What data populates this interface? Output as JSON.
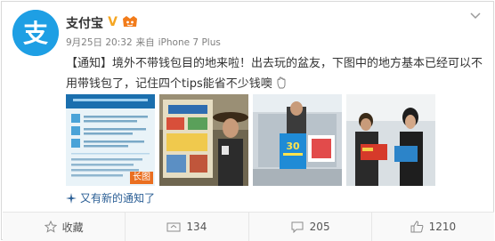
{
  "user": {
    "name": "支付宝",
    "verified_badge": "V"
  },
  "meta": {
    "date": "9月25日 20:32",
    "from_label": "来自",
    "device": "iPhone 7 Plus"
  },
  "post": {
    "text": "【通知】境外不带钱包目的地来啦！出去玩的盆友，下图中的地方基本已经可以不用带钱包了，记住四个tips能省不少钱噢"
  },
  "thumbnails": [
    {
      "kind": "long-image",
      "badge": "长图",
      "scene": "infographic"
    },
    {
      "kind": "photo",
      "scene": "shop-map"
    },
    {
      "kind": "photo",
      "scene": "store-display"
    },
    {
      "kind": "photo",
      "scene": "travelers-reading"
    }
  ],
  "notice_link": "又有新的通知了",
  "actions": {
    "favorite": "收藏",
    "repost": "134",
    "comment": "205",
    "like": "1210"
  },
  "colors": {
    "brand_blue": "#1e9fe4",
    "verified_orange": "#f5a623",
    "link_blue": "#2a5e95",
    "badge_orange": "#ea6f21"
  }
}
